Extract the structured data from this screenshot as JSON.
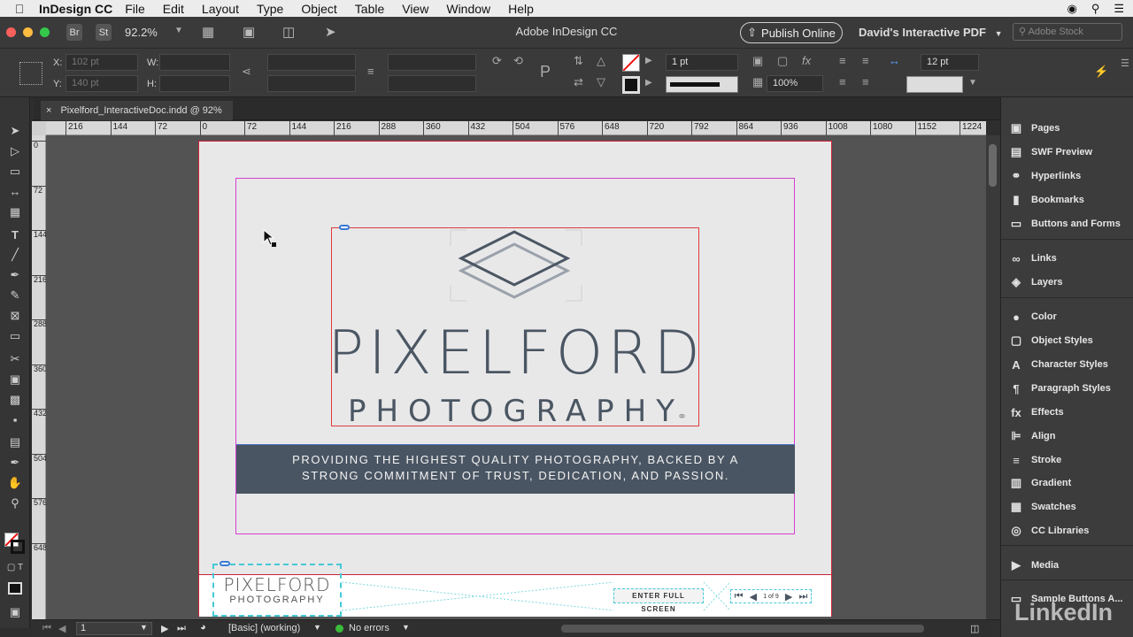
{
  "menubar": {
    "app_name": "InDesign CC",
    "items": [
      "File",
      "Edit",
      "Layout",
      "Type",
      "Object",
      "Table",
      "View",
      "Window",
      "Help"
    ],
    "right_icons": [
      "creative-cloud-icon",
      "spotlight-search-icon",
      "menu-list-icon"
    ]
  },
  "appbar": {
    "title": "Adobe InDesign CC",
    "br_label": "Br",
    "st_label": "St",
    "zoom": "92.2%",
    "publish_label": "Publish Online",
    "workspace": "David's Interactive PDF",
    "stock_placeholder": "Adobe Stock"
  },
  "control": {
    "x_label": "X:",
    "x_value": "102 pt",
    "y_label": "Y:",
    "y_value": "140 pt",
    "w_label": "W:",
    "h_label": "H:",
    "stroke_weight": "1 pt",
    "scale_pct": "100%",
    "gap_value": "12 pt"
  },
  "doc_tab": {
    "title": "Pixelford_InteractiveDoc.indd @ 92%",
    "close": "×"
  },
  "ruler": {
    "h_labels": [
      "216",
      "144",
      "72",
      "0",
      "72",
      "144",
      "216",
      "288",
      "360",
      "432",
      "504",
      "576",
      "648",
      "720",
      "792",
      "864",
      "936",
      "1008",
      "1080",
      "1152",
      "1224"
    ],
    "v_labels": [
      "0",
      "72",
      "144",
      "216",
      "288",
      "360",
      "432",
      "504",
      "576",
      "648"
    ]
  },
  "document": {
    "brand_name": "PIXELFORD",
    "brand_sub": "PHOTOGRAPHY",
    "banner_line1": "PROVIDING THE HIGHEST QUALITY PHOTOGRAPHY, BACKED BY A",
    "banner_line2": "STRONG COMMITMENT OF TRUST, DEDICATION, AND PASSION.",
    "footer_brand": "PIXELFORD",
    "footer_sub": "PHOTOGRAPHY",
    "fullscreen_label": "ENTER FULL SCREEN",
    "pager_text": "1 of 9"
  },
  "panels": [
    {
      "label": "Pages",
      "icon": "pages-icon",
      "glyph": "▣"
    },
    {
      "label": "SWF Preview",
      "icon": "swf-preview-icon",
      "glyph": "▤"
    },
    {
      "label": "Hyperlinks",
      "icon": "hyperlinks-icon",
      "glyph": "⚭"
    },
    {
      "label": "Bookmarks",
      "icon": "bookmark-icon",
      "glyph": "▮"
    },
    {
      "label": "Buttons and Forms",
      "icon": "buttons-forms-icon",
      "glyph": "▭"
    },
    {
      "label": "Links",
      "icon": "links-icon",
      "glyph": "∞"
    },
    {
      "label": "Layers",
      "icon": "layers-icon",
      "glyph": "◈"
    },
    {
      "label": "Color",
      "icon": "color-icon",
      "glyph": "●"
    },
    {
      "label": "Object Styles",
      "icon": "object-styles-icon",
      "glyph": "▢"
    },
    {
      "label": "Character Styles",
      "icon": "character-styles-icon",
      "glyph": "A"
    },
    {
      "label": "Paragraph Styles",
      "icon": "paragraph-styles-icon",
      "glyph": "¶"
    },
    {
      "label": "Effects",
      "icon": "effects-icon",
      "glyph": "fx"
    },
    {
      "label": "Align",
      "icon": "align-icon",
      "glyph": "⊫"
    },
    {
      "label": "Stroke",
      "icon": "stroke-icon",
      "glyph": "≡"
    },
    {
      "label": "Gradient",
      "icon": "gradient-icon",
      "glyph": "▥"
    },
    {
      "label": "Swatches",
      "icon": "swatches-icon",
      "glyph": "▦"
    },
    {
      "label": "CC Libraries",
      "icon": "cc-libraries-icon",
      "glyph": "◎"
    },
    {
      "label": "Media",
      "icon": "media-icon",
      "glyph": "▶"
    },
    {
      "label": "Sample Buttons A...",
      "icon": "sample-buttons-icon",
      "glyph": "▭"
    }
  ],
  "status": {
    "page_number": "1",
    "preflight_profile": "[Basic] (working)",
    "errors": "No errors"
  },
  "watermark": "LinkedIn",
  "colors": {
    "banner": "#4a5563",
    "brand_text": "#4b5663",
    "frame_selection": "#e13b3b",
    "margin_guide": "#d43fd0",
    "button_dashed": "#46c9d6",
    "status_ok": "#3bbb3b"
  }
}
